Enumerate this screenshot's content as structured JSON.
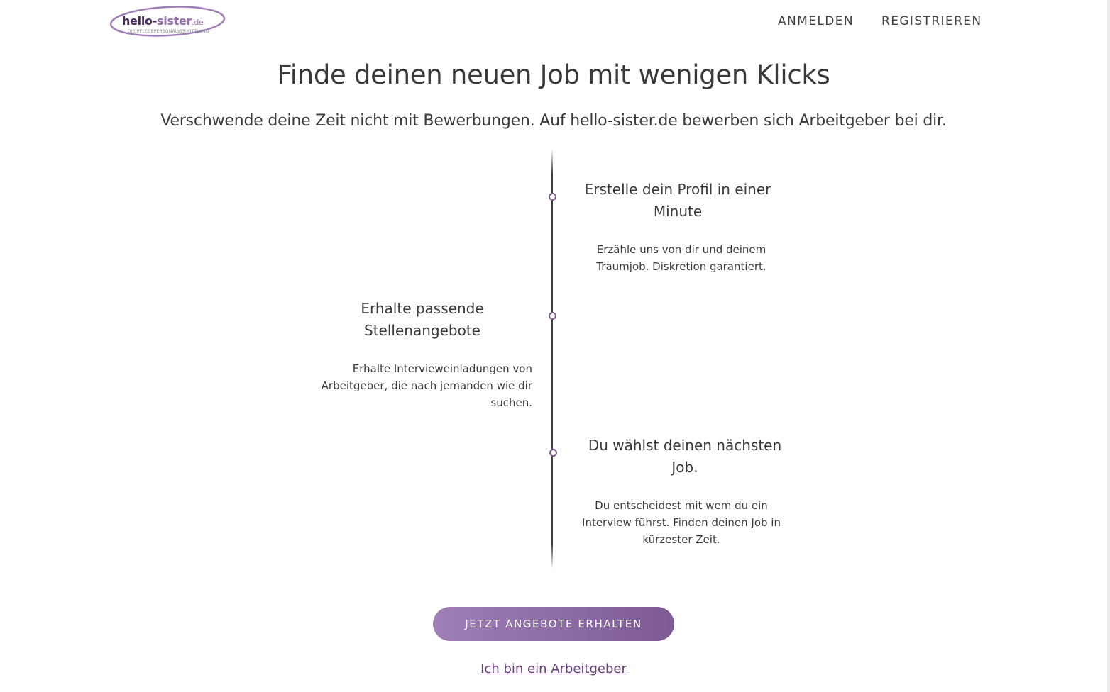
{
  "header": {
    "logo": {
      "name_part1": "hello-",
      "name_part2": "sister",
      "name_part3": ".de",
      "tagline": "DIE PFLEGEPERSONALVERMITTLUNG"
    },
    "nav": {
      "login_label": "ANMELDEN",
      "register_label": "REGISTRIEREN"
    }
  },
  "hero": {
    "title": "Finde deinen neuen Job mit wenigen Klicks",
    "subtitle": "Verschwende deine Zeit nicht mit Bewerbungen. Auf hello-sister.de bewerben sich Arbeitgeber bei dir."
  },
  "timeline": {
    "steps": [
      {
        "title": "Erstelle dein Profil in einer Minute",
        "text": "Erzähle uns von dir und deinem Traumjob. Diskretion garantiert."
      },
      {
        "title": "Erhalte passende Stellenangebote",
        "text": "Erhalte Interviewеinladungen von Arbeitgeber, die nach jemanden wie dir suchen."
      },
      {
        "title": "Du wählst deinen nächsten Job.",
        "text": "Du entscheidest mit wem du ein Interview führst. Finden deinen Job in kürzester Zeit."
      }
    ]
  },
  "cta": {
    "button_label": "JETZT ANGEBOTE ERHALTEN",
    "employer_link": "Ich bin ein Arbeitgeber"
  },
  "colors": {
    "brand_dark": "#4a2d5e",
    "brand_light": "#9a6fb0",
    "button_start": "#a07fb8",
    "button_end": "#7d5a93",
    "link": "#6a3d7d"
  }
}
